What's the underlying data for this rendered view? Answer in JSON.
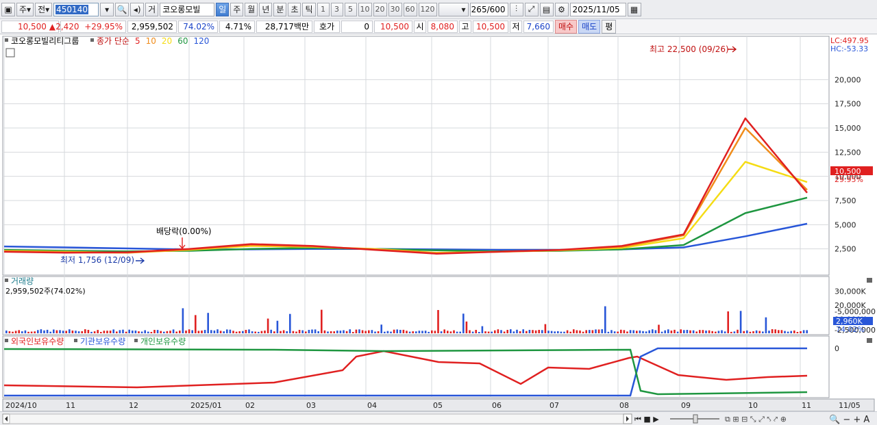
{
  "toolbar": {
    "market_label": "주",
    "scope_label": "전",
    "stock_code": "450140",
    "stock_name": "코오롱모빌",
    "period_tabs": [
      "거",
      "일",
      "주",
      "월",
      "년",
      "분",
      "초",
      "틱"
    ],
    "active_period": "일",
    "interval_options": [
      "1",
      "3",
      "5",
      "10",
      "20",
      "30",
      "60",
      "120"
    ],
    "view_count": "265",
    "view_total": "/600",
    "date": "2025/11/05"
  },
  "quote": {
    "price": "10,500",
    "change": "2,420",
    "change_pct": "+29.95%",
    "volume": "2,959,502",
    "volume_ratio": "74.02%",
    "turnover": "4.71%",
    "amount": "28,717백만",
    "bid_label": "호가",
    "bid_value": "0",
    "bid_price": "10,500",
    "open_label": "시",
    "open": "8,080",
    "high_label": "고",
    "high": "10,500",
    "low_label": "저",
    "low": "7,660",
    "buy_label": "매수",
    "sell_label": "매도",
    "eval_label": "평"
  },
  "price_panel": {
    "stock_label": "코오롱모빌리티그룹",
    "ma_label": "종가 단순",
    "ma_periods": [
      {
        "label": "5",
        "color": "#e02020"
      },
      {
        "label": "10",
        "color": "#f08c1a"
      },
      {
        "label": "20",
        "color": "#f5dc14"
      },
      {
        "label": "60",
        "color": "#1e9640"
      },
      {
        "label": "120",
        "color": "#2856d8"
      }
    ],
    "lc_label": "LC:497.95",
    "hc_label": "HC:-53.33",
    "high_annotation": "최고 22,500 (09/26)",
    "low_annotation": "최저 1,756 (12/09)",
    "dividend_annotation": "배당락(0.00%)",
    "y_ticks": [
      "20,000",
      "17,500",
      "15,000",
      "12,500",
      "10,000",
      "7,500",
      "5,000",
      "2,500"
    ],
    "current_price_tag": "10,500",
    "current_pct_tag": "29.95%"
  },
  "volume_panel": {
    "title": "거래량",
    "value": "2,959,502주(74.02%)",
    "y_ticks": [
      "30,000K",
      "20,000K",
      "10,000K"
    ],
    "current_tag": "2,960K",
    "current_pct": "74.02%"
  },
  "holding_panel": {
    "series": [
      {
        "label": "외국인보유수량",
        "color": "#e02020"
      },
      {
        "label": "기관보유수량",
        "color": "#2856d8"
      },
      {
        "label": "개인보유수량",
        "color": "#1e9640"
      }
    ],
    "y_ticks": [
      "0",
      "-2,500,000",
      "-5,000,000"
    ]
  },
  "x_axis": {
    "labels": [
      "2024/10",
      "11",
      "12",
      "2025/01",
      "02",
      "03",
      "04",
      "05",
      "06",
      "07",
      "08",
      "09",
      "10",
      "11",
      "11/05"
    ]
  },
  "chart_data": {
    "type": "line",
    "title": "",
    "x": [
      "2024/10",
      "11",
      "12",
      "2025/01",
      "02",
      "03",
      "04",
      "05",
      "06",
      "07",
      "08",
      "09",
      "10",
      "11"
    ],
    "series": [
      {
        "name": "5",
        "values": [
          2200,
          2100,
          2150,
          2500,
          3000,
          2800,
          2400,
          2000,
          2200,
          2400,
          2800,
          4000,
          16000,
          8300
        ]
      },
      {
        "name": "10",
        "values": [
          2250,
          2150,
          2100,
          2450,
          2900,
          2750,
          2450,
          2050,
          2200,
          2380,
          2700,
          3900,
          15000,
          8600
        ]
      },
      {
        "name": "20",
        "values": [
          2300,
          2200,
          2100,
          2400,
          2800,
          2700,
          2500,
          2100,
          2200,
          2350,
          2600,
          3600,
          11500,
          9400
        ]
      },
      {
        "name": "60",
        "values": [
          2400,
          2300,
          2250,
          2300,
          2500,
          2600,
          2500,
          2350,
          2250,
          2300,
          2450,
          2900,
          6200,
          7800
        ]
      },
      {
        "name": "120",
        "values": [
          2750,
          2650,
          2550,
          2450,
          2450,
          2500,
          2500,
          2450,
          2400,
          2400,
          2450,
          2650,
          3800,
          5100
        ]
      }
    ],
    "ylim": [
      0,
      22500
    ]
  }
}
